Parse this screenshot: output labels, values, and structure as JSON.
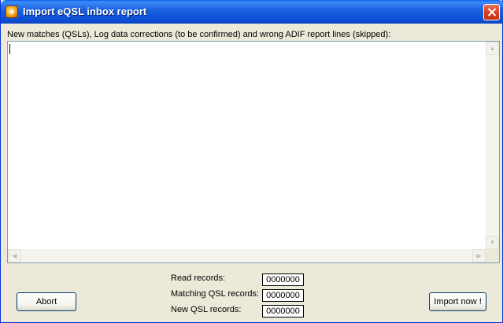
{
  "window": {
    "title": "Import eQSL inbox report"
  },
  "caption": "New matches (QSLs), Log data corrections (to be confirmed) and wrong ADIF report lines (skipped):",
  "memo": {
    "text": ""
  },
  "stats": {
    "read_label": "Read records:",
    "read_value": "0000000",
    "matching_label": "Matching QSL records:",
    "matching_value": "0000000",
    "new_label": "New QSL records:",
    "new_value": "0000000"
  },
  "buttons": {
    "abort": "Abort",
    "import": "Import now !"
  },
  "icons": {
    "app": "app-icon",
    "close": "close-icon"
  },
  "colors": {
    "titlebar": "#0C50D8",
    "close": "#D9411D",
    "face": "#ECE9D8"
  }
}
